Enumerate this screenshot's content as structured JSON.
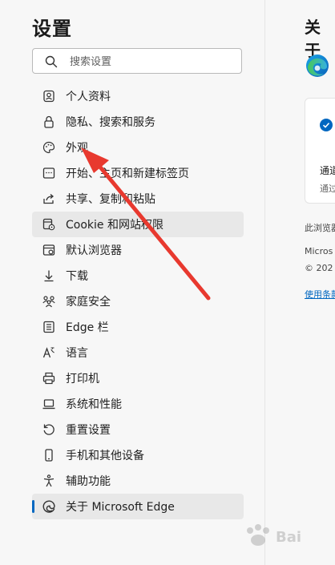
{
  "sidebar": {
    "title": "设置",
    "search_placeholder": "搜索设置",
    "items": [
      {
        "label": "个人资料"
      },
      {
        "label": "隐私、搜索和服务"
      },
      {
        "label": "外观"
      },
      {
        "label": "开始、主页和新建标签页"
      },
      {
        "label": "共享、复制和粘贴"
      },
      {
        "label": "Cookie 和网站权限"
      },
      {
        "label": "默认浏览器"
      },
      {
        "label": "下载"
      },
      {
        "label": "家庭安全"
      },
      {
        "label": "Edge 栏"
      },
      {
        "label": "语言"
      },
      {
        "label": "打印机"
      },
      {
        "label": "系统和性能"
      },
      {
        "label": "重置设置"
      },
      {
        "label": "手机和其他设备"
      },
      {
        "label": "辅助功能"
      },
      {
        "label": "关于 Microsoft Edge"
      }
    ]
  },
  "main": {
    "title": "关于",
    "card_line1": "通道",
    "card_line2": "通过",
    "text1": "此浏览器",
    "text2": "Micros",
    "text3": "© 202",
    "link": "使用条款"
  },
  "colors": {
    "accent": "#0067c0",
    "arrow": "#e8392f",
    "highlight": "#e8e8e8"
  }
}
